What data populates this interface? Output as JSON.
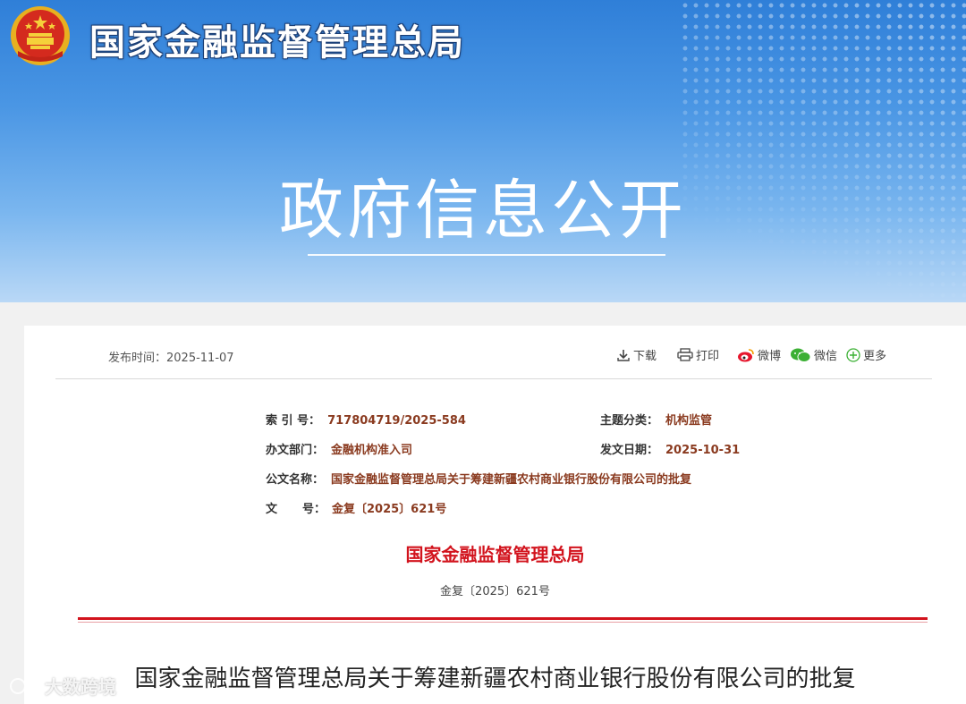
{
  "header": {
    "site_title": "国家金融监督管理总局",
    "section_title": "政府信息公开"
  },
  "toolbar": {
    "publish_label": "发布时间：",
    "publish_date": "2025-11-07",
    "download": "下载",
    "print": "打印",
    "weibo": "微博",
    "wechat": "微信",
    "more": "更多"
  },
  "info": {
    "index_label": "索 引 号：",
    "index_value": "717804719/2025-584",
    "topic_label": "主题分类：",
    "topic_value": "机构监管",
    "dept_label": "办文部门：",
    "dept_value": "金融机构准入司",
    "date_label": "发文日期：",
    "date_value": "2025-10-31",
    "name_label": "公文名称：",
    "name_value": "国家金融监督管理总局关于筹建新疆农村商业银行股份有限公司的批复",
    "docno_label_a": "文",
    "docno_label_b": "号：",
    "docno_value": "金复〔2025〕621号"
  },
  "document": {
    "issuer": "国家金融监督管理总局",
    "doc_number": "金复〔2025〕621号",
    "title": "国家金融监督管理总局关于筹建新疆农村商业银行股份有限公司的批复"
  },
  "watermark": {
    "text": "大数跨境"
  },
  "colors": {
    "accent_red": "#d2131d",
    "banner_blue": "#2f7fd8",
    "value_brown": "#8a3a1f"
  }
}
